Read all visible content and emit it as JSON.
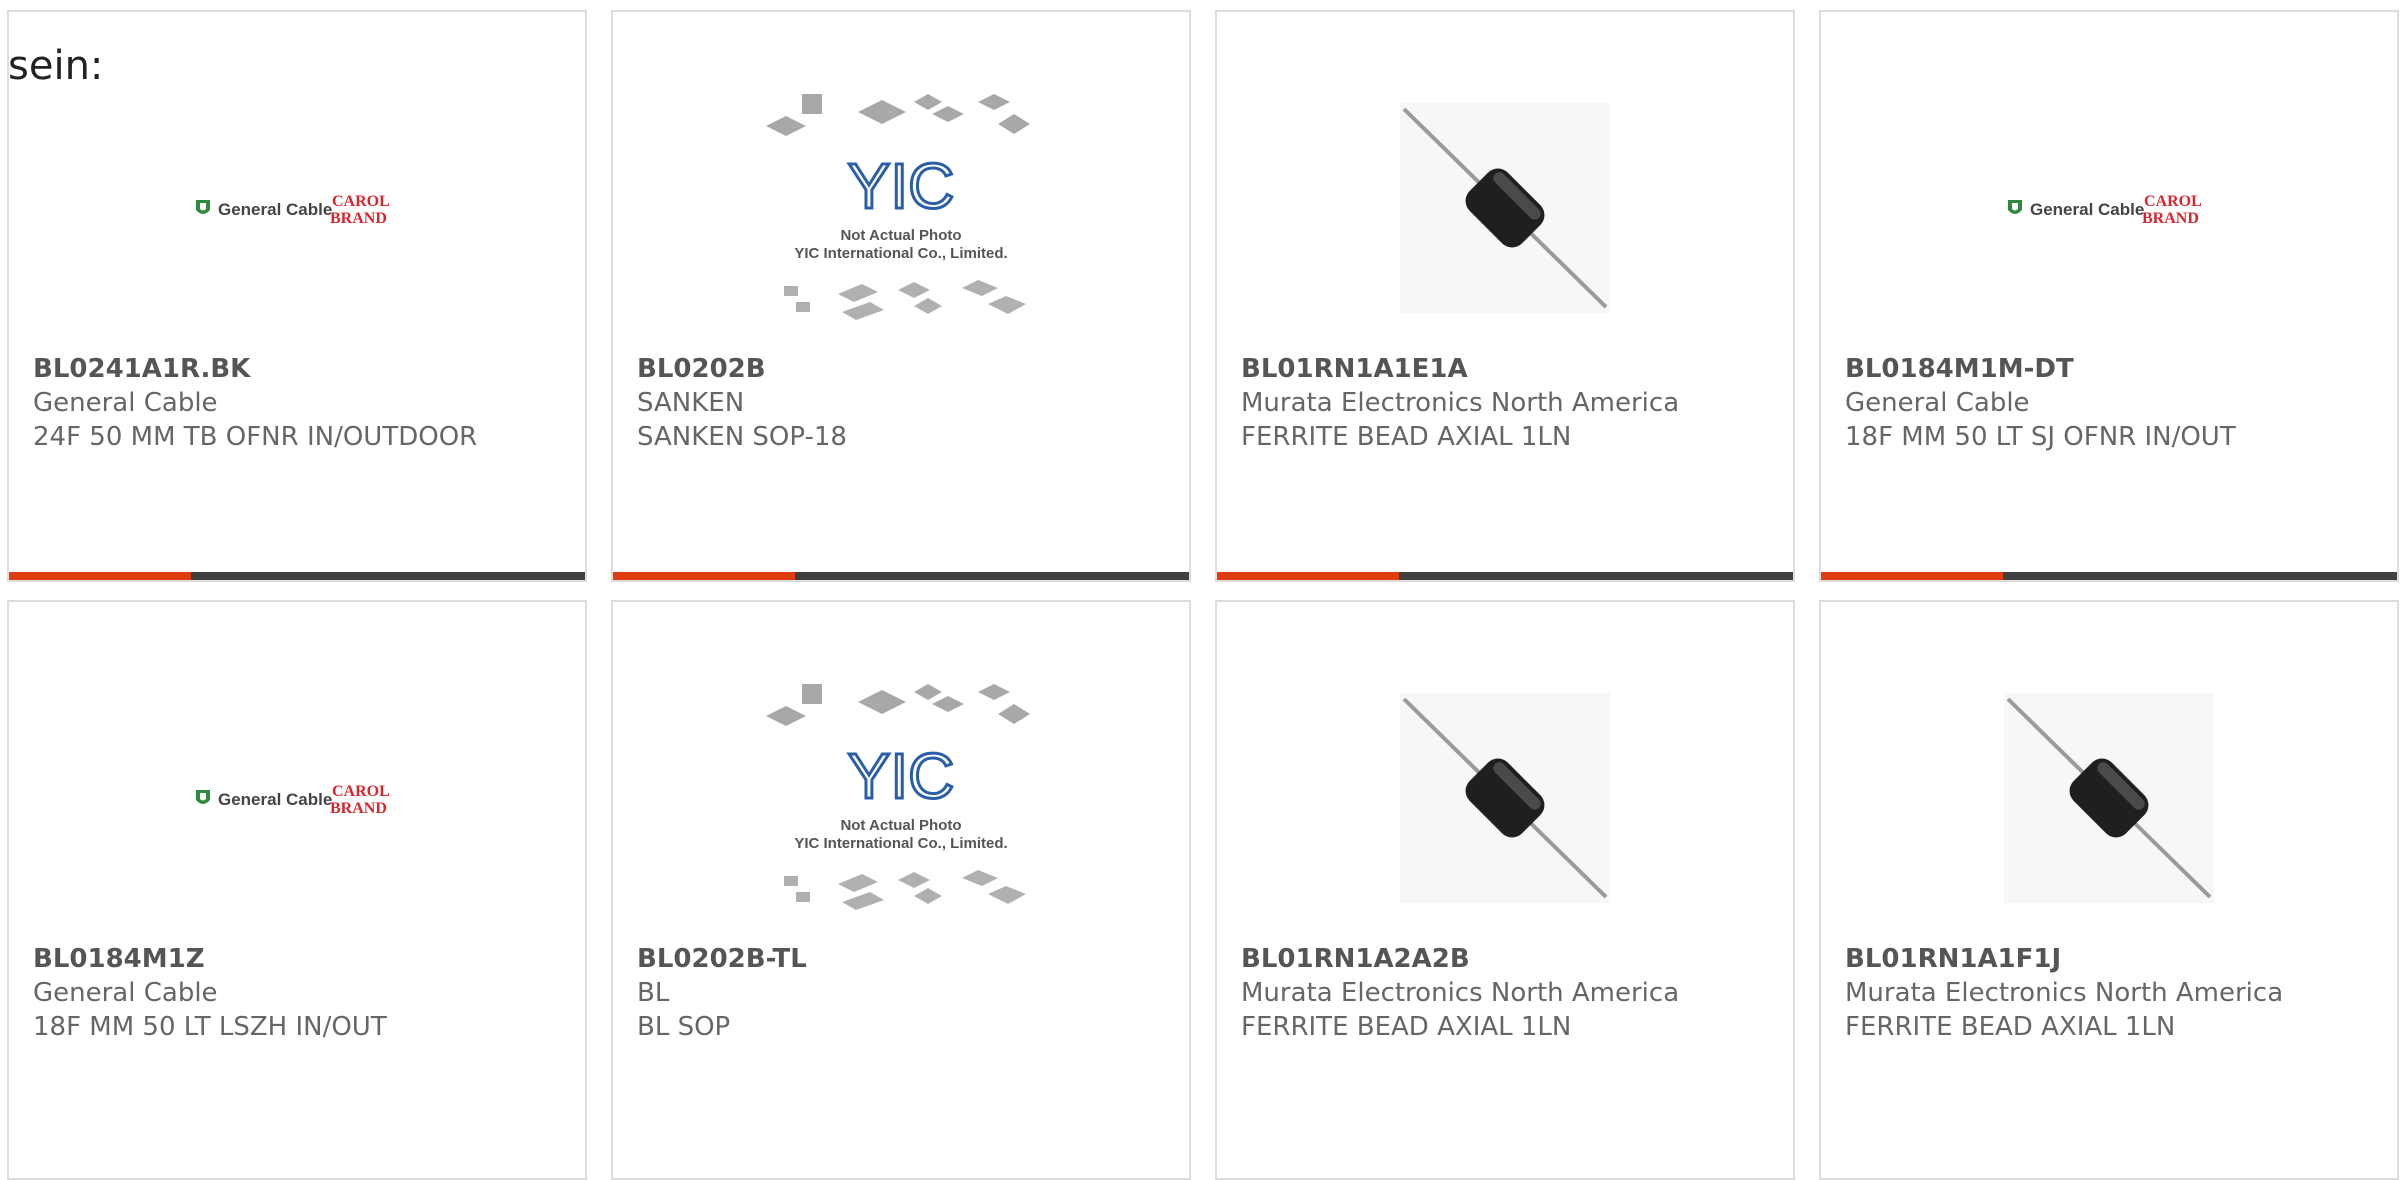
{
  "intro": {
    "text": "sein:"
  },
  "theme": {
    "accent": "#e03c0f",
    "bar_dark": "#3f3f3f",
    "border": "#dddddd",
    "text": "#555555"
  },
  "images": {
    "general_cable": {
      "brand_left": "General Cable",
      "brand_right_top": "CAROL",
      "brand_right_bottom": "BRAND"
    },
    "yic": {
      "logo": "YIC",
      "line1": "Not Actual Photo",
      "line2": "YIC International Co., Limited."
    }
  },
  "products": [
    {
      "part": "BL0241A1R.BK",
      "manufacturer": "General Cable",
      "description": "24F 50 MM TB OFNR IN/OUTDOOR",
      "image": "general-cable-logo"
    },
    {
      "part": "BL0202B",
      "manufacturer": "SANKEN",
      "description": "SANKEN SOP-18",
      "image": "yic-placeholder"
    },
    {
      "part": "BL01RN1A1E1A",
      "manufacturer": "Murata Electronics North America",
      "description": "FERRITE BEAD AXIAL 1LN",
      "image": "ferrite-bead-photo"
    },
    {
      "part": "BL0184M1M-DT",
      "manufacturer": "General Cable",
      "description": "18F MM 50 LT SJ OFNR IN/OUT",
      "image": "general-cable-logo"
    },
    {
      "part": "BL0184M1Z",
      "manufacturer": "General Cable",
      "description": "18F MM 50 LT LSZH IN/OUT",
      "image": "general-cable-logo"
    },
    {
      "part": "BL0202B-TL",
      "manufacturer": "BL",
      "description": "BL SOP",
      "image": "yic-placeholder"
    },
    {
      "part": "BL01RN1A2A2B",
      "manufacturer": "Murata Electronics North America",
      "description": "FERRITE BEAD AXIAL 1LN",
      "image": "ferrite-bead-photo"
    },
    {
      "part": "BL01RN1A1F1J",
      "manufacturer": "Murata Electronics North America",
      "description": "FERRITE BEAD AXIAL 1LN",
      "image": "ferrite-bead-photo"
    }
  ]
}
